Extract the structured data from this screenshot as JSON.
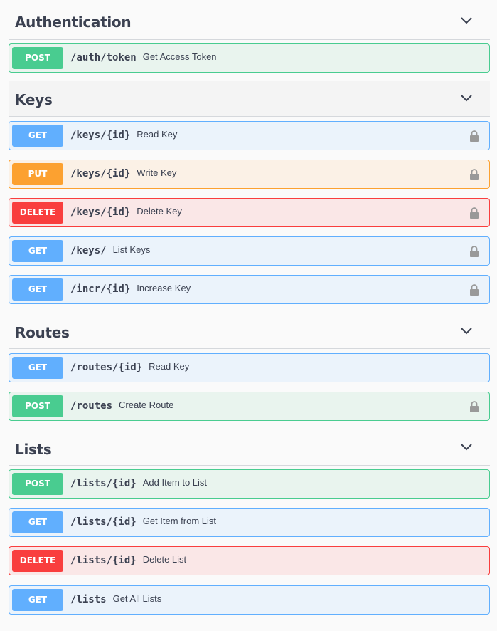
{
  "colors": {
    "post": "#49cc90",
    "get": "#61affe",
    "put": "#fca130",
    "delete": "#f93e3e",
    "text": "#3b4151"
  },
  "sections": [
    {
      "title": "Authentication",
      "icon": "chevron-down-icon",
      "operations": [
        {
          "method": "POST",
          "path": "/auth/token",
          "summary": "Get Access Token",
          "locked": false
        }
      ]
    },
    {
      "title": "Keys",
      "icon": "chevron-down-icon",
      "operations": [
        {
          "method": "GET",
          "path": "/keys/{id}",
          "summary": "Read Key",
          "locked": true
        },
        {
          "method": "PUT",
          "path": "/keys/{id}",
          "summary": "Write Key",
          "locked": true
        },
        {
          "method": "DELETE",
          "path": "/keys/{id}",
          "summary": "Delete Key",
          "locked": true
        },
        {
          "method": "GET",
          "path": "/keys/",
          "summary": "List Keys",
          "locked": true
        },
        {
          "method": "GET",
          "path": "/incr/{id}",
          "summary": "Increase Key",
          "locked": true
        }
      ]
    },
    {
      "title": "Routes",
      "icon": "chevron-down-icon",
      "operations": [
        {
          "method": "GET",
          "path": "/routes/{id}",
          "summary": "Read Key",
          "locked": false
        },
        {
          "method": "POST",
          "path": "/routes",
          "summary": "Create Route",
          "locked": true
        }
      ]
    },
    {
      "title": "Lists",
      "icon": "chevron-down-icon",
      "operations": [
        {
          "method": "POST",
          "path": "/lists/{id}",
          "summary": "Add Item to List",
          "locked": false
        },
        {
          "method": "GET",
          "path": "/lists/{id}",
          "summary": "Get Item from List",
          "locked": false
        },
        {
          "method": "DELETE",
          "path": "/lists/{id}",
          "summary": "Delete List",
          "locked": false
        },
        {
          "method": "GET",
          "path": "/lists",
          "summary": "Get All Lists",
          "locked": false
        }
      ]
    }
  ]
}
